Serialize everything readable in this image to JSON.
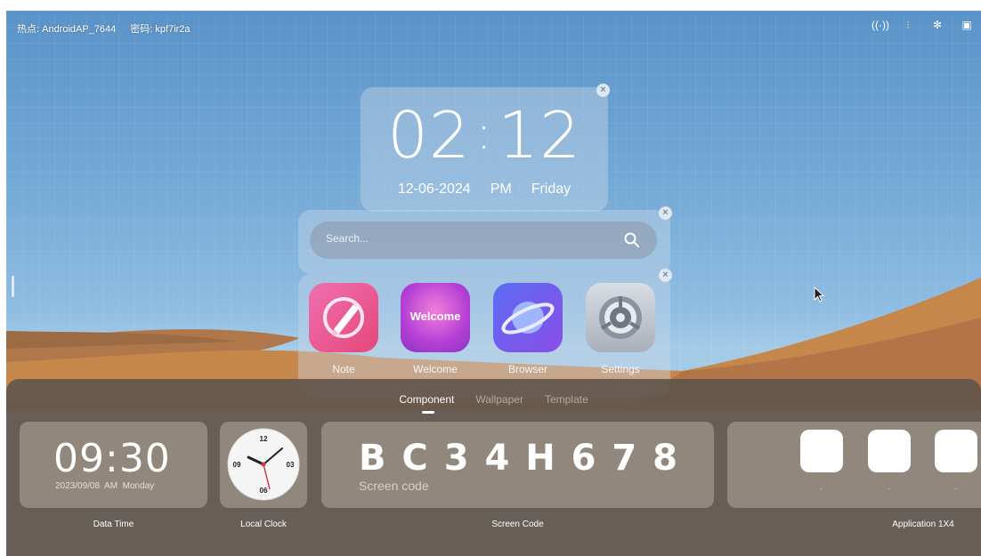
{
  "status_bar": {
    "hotspot": "热点: AndroidAP_7644",
    "password": "密码: kpf7ir2a"
  },
  "tray_icons": [
    "signal-icon",
    "wifi-icon",
    "bluetooth-icon",
    "screen-icon"
  ],
  "clock_widget": {
    "hours": "02",
    "minutes": "12",
    "date": "12-06-2024",
    "ampm": "PM",
    "weekday": "Friday"
  },
  "search": {
    "placeholder": "Search..."
  },
  "apps": [
    {
      "label": "Note"
    },
    {
      "label": "Welcome",
      "tile_text": "Welcome"
    },
    {
      "label": "Browser"
    },
    {
      "label": "Settings"
    }
  ],
  "panel": {
    "tabs": [
      "Component",
      "Wallpaper",
      "Template"
    ],
    "active_tab": "Component",
    "widgets": {
      "datetime": {
        "time": "09:30",
        "sub": "2023/09/08  AM  Monday",
        "label": "Data Time"
      },
      "local_clock": {
        "numerals": [
          "12",
          "03",
          "06",
          "09"
        ],
        "label": "Local Clock"
      },
      "screen_code": {
        "code": "B C 3 4 H 6 7 8",
        "caption": "Screen code",
        "label": "Screen Code"
      },
      "application": {
        "label": "Application 1X4",
        "dots": [
          ".",
          ".",
          "."
        ]
      }
    }
  }
}
